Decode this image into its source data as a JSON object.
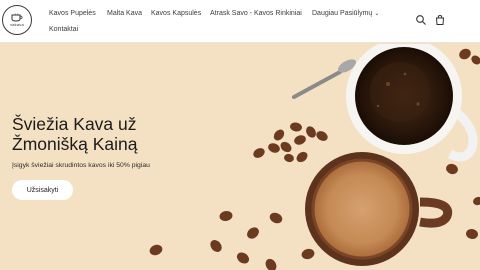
{
  "brand": {
    "logo_text": "vakava"
  },
  "nav": {
    "items": [
      {
        "label": "Kavos Pupelės"
      },
      {
        "label": "Malta Kava"
      },
      {
        "label": "Kavos Kapsulės"
      },
      {
        "label": "Atrask Savo - Kavos Rinkiniai"
      },
      {
        "label": "Daugiau Pasiūlymų"
      },
      {
        "label": "Kontaktai"
      }
    ]
  },
  "header_icons": {
    "search": "search-icon",
    "cart": "shopping-bag-icon"
  },
  "hero": {
    "title_line1": "Šviežia Kava už",
    "title_line2": "Žmonišką Kainą",
    "subtitle": "Įsigyk šviežiai skrudintos kavos iki 50% pigiau",
    "cta_label": "Užsisakyti"
  },
  "colors": {
    "background": "#f3dfc1",
    "header": "#ffffff",
    "text": "#1c1c1c"
  }
}
